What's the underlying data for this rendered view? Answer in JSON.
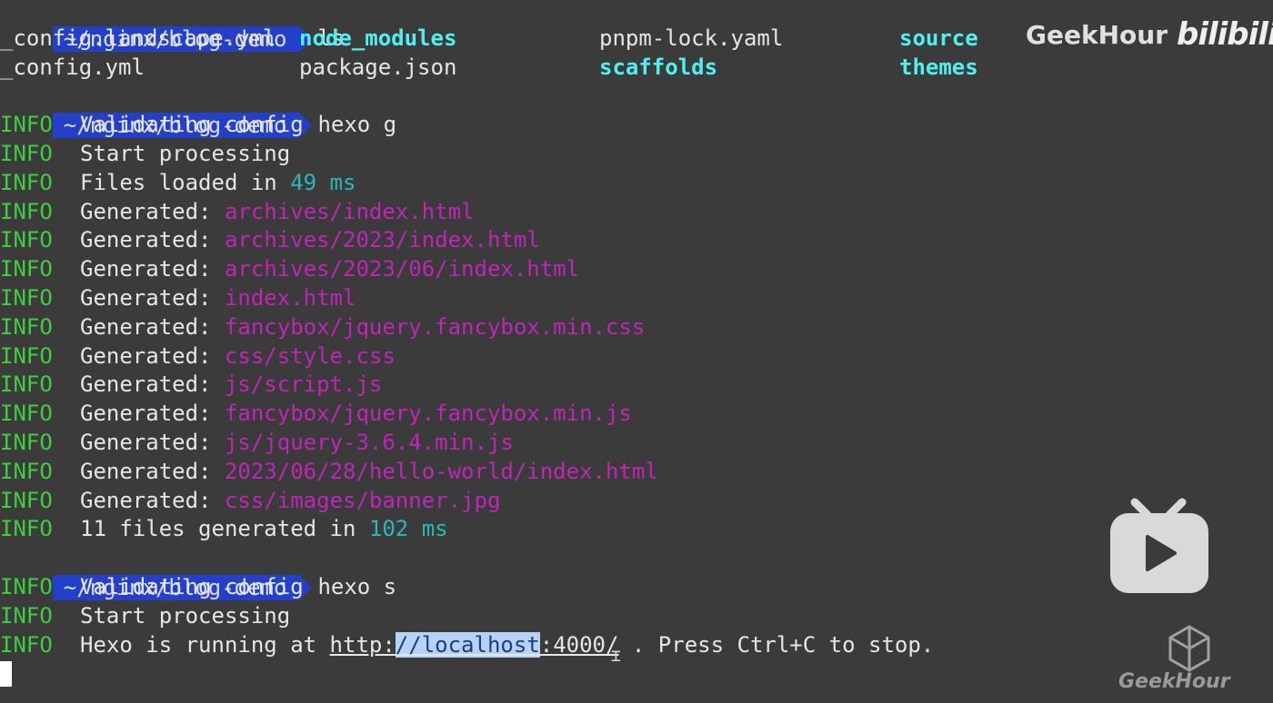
{
  "prompt_path": "~/nginx/blog-demo",
  "commands": {
    "ls": "ls",
    "generate": "hexo g",
    "server": "hexo s"
  },
  "info_label": "INFO",
  "ls_output": {
    "row1": [
      "_config.landscape.yml",
      "node_modules",
      "pnpm-lock.yaml",
      "source"
    ],
    "row2": [
      "_config.yml",
      "package.json",
      "scaffolds",
      "themes"
    ]
  },
  "gen_lines": {
    "validating": "Validating config",
    "start": "Start processing",
    "files_loaded_prefix": "Files loaded in ",
    "files_loaded_time": "49 ms",
    "generated_label": "Generated: ",
    "generated_files": [
      "archives/index.html",
      "archives/2023/index.html",
      "archives/2023/06/index.html",
      "index.html",
      "fancybox/jquery.fancybox.min.css",
      "css/style.css",
      "js/script.js",
      "fancybox/jquery.fancybox.min.js",
      "js/jquery-3.6.4.min.js",
      "2023/06/28/hello-world/index.html",
      "css/images/banner.jpg"
    ],
    "summary_prefix": "11 files generated in ",
    "summary_time": "102 ms"
  },
  "server_lines": {
    "validating": "Validating config",
    "start": "Start processing",
    "running_prefix": "Hexo is running at ",
    "url_scheme": "http:",
    "url_host_selected": "//localhost",
    "url_rest": ":4000/",
    "running_suffix": " . Press Ctrl+C to stop."
  },
  "watermark": {
    "channel": "GeekHour",
    "site": "bilibili",
    "bottom_label": "GeekHour"
  },
  "colors": {
    "background": "#3b3b3b",
    "prompt_bg": "#2540c8",
    "info": "#3ecf3e",
    "file": "#c025b8",
    "time": "#29b8b8",
    "dir": "#4ff0f0"
  }
}
